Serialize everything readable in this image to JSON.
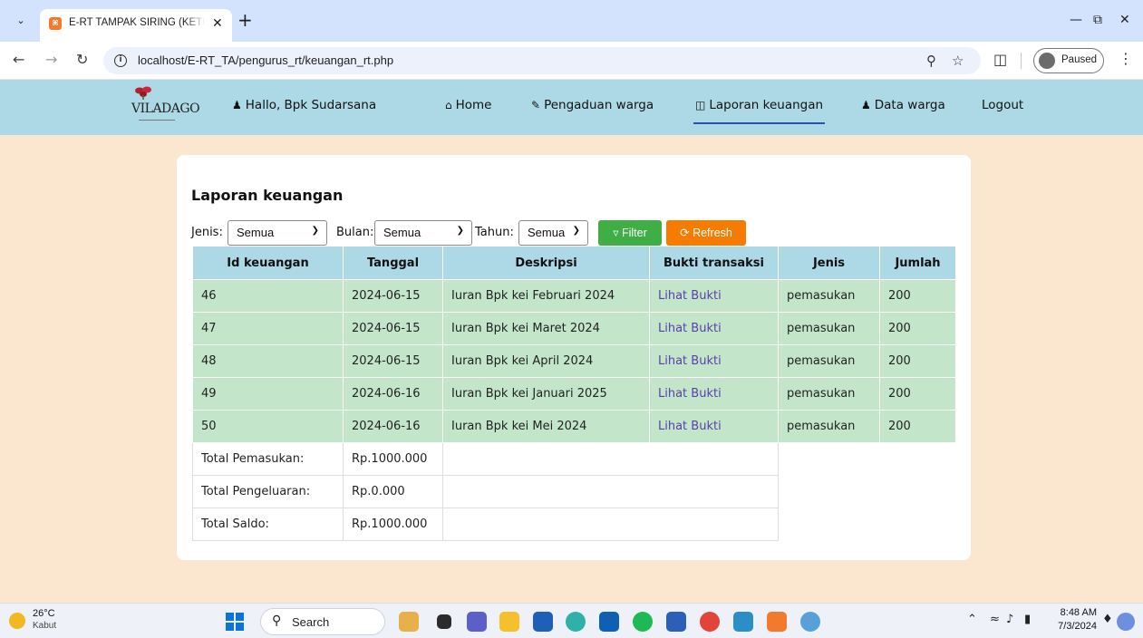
{
  "browser": {
    "tab_title": "E-RT TAMPAK SIRING (KETUA RT",
    "url": "localhost/E-RT_TA/pengurus_rt/keuangan_rt.php",
    "profile_label": "Paused"
  },
  "navbar": {
    "logo_text": "VILADAGO",
    "greeting": "Hallo, Bpk Sudarsana",
    "items": [
      {
        "label": "Home",
        "icon": "home-icon"
      },
      {
        "label": "Pengaduan warga",
        "icon": "edit-icon"
      },
      {
        "label": "Laporan keuangan",
        "icon": "database-icon",
        "active": true
      },
      {
        "label": "Data warga",
        "icon": "users-icon"
      },
      {
        "label": "Logout"
      }
    ]
  },
  "report": {
    "title": "Laporan keuangan",
    "filters": {
      "jenis_label": "Jenis:",
      "jenis_value": "Semua",
      "bulan_label": "Bulan:",
      "bulan_value": "Semua",
      "tahun_label": "Tahun:",
      "tahun_value": "Semua",
      "filter_button": "Filter",
      "refresh_button": "Refresh"
    },
    "columns": [
      "Id keuangan",
      "Tanggal",
      "Deskripsi",
      "Bukti transaksi",
      "Jenis",
      "Jumlah"
    ],
    "rows": [
      {
        "id": "46",
        "tanggal": "2024-06-15",
        "deskripsi": "Iuran Bpk kei Februari 2024",
        "bukti": "Lihat Bukti",
        "jenis": "pemasukan",
        "jumlah": "200"
      },
      {
        "id": "47",
        "tanggal": "2024-06-15",
        "deskripsi": "Iuran Bpk kei Maret 2024",
        "bukti": "Lihat Bukti",
        "jenis": "pemasukan",
        "jumlah": "200"
      },
      {
        "id": "48",
        "tanggal": "2024-06-15",
        "deskripsi": "Iuran Bpk kei April 2024",
        "bukti": "Lihat Bukti",
        "jenis": "pemasukan",
        "jumlah": "200"
      },
      {
        "id": "49",
        "tanggal": "2024-06-16",
        "deskripsi": "Iuran Bpk kei Januari 2025",
        "bukti": "Lihat Bukti",
        "jenis": "pemasukan",
        "jumlah": "200"
      },
      {
        "id": "50",
        "tanggal": "2024-06-16",
        "deskripsi": "Iuran Bpk kei Mei 2024",
        "bukti": "Lihat Bukti",
        "jenis": "pemasukan",
        "jumlah": "200"
      }
    ],
    "totals": [
      {
        "label": "Total Pemasukan:",
        "value": "Rp.1000.000"
      },
      {
        "label": "Total Pengeluaran:",
        "value": "Rp.0.000"
      },
      {
        "label": "Total Saldo:",
        "value": "Rp.1000.000"
      }
    ]
  },
  "taskbar": {
    "weather_temp": "26°C",
    "weather_desc": "Kabut",
    "search_label": "Search",
    "time": "8:48 AM",
    "date": "7/3/2024"
  },
  "colors": {
    "navbar_bg": "#add8e6",
    "page_bg": "#fbe6cf",
    "row_bg": "#c3e6cb",
    "filter_btn": "#3fae44",
    "refresh_btn": "#f57c00",
    "active_underline": "#2c4eb8"
  }
}
